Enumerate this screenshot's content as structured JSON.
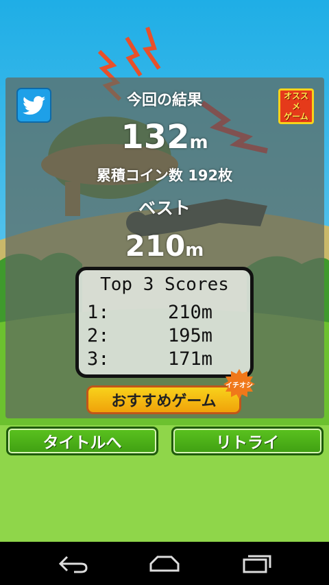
{
  "result": {
    "title": "今回の結果",
    "distance": "132",
    "distance_unit": "m",
    "coins": "累積コイン数 192枚",
    "best_label": "ベスト",
    "best_value": "210",
    "best_unit": "m"
  },
  "top_scores": {
    "title": "Top 3 Scores",
    "rows": [
      {
        "rank": "1:",
        "value": "210m"
      },
      {
        "rank": "2:",
        "value": "195m"
      },
      {
        "rank": "3:",
        "value": "171m"
      }
    ]
  },
  "buttons": {
    "recommended_game": "おすすめゲーム",
    "ichioshi_badge": "イチオシ",
    "recommend_line1": "オススメ",
    "recommend_line2": "ゲーム",
    "title": "タイトルへ",
    "retry": "リトライ"
  },
  "icons": {
    "twitter": "twitter-bird-icon",
    "back": "back-icon",
    "home": "home-icon",
    "recents": "recents-icon"
  },
  "colors": {
    "sky": "#29b6e6",
    "accent_green": "#4caf1a",
    "twitter_blue": "#1ea0e8",
    "orange_button": "#f8c21b"
  }
}
